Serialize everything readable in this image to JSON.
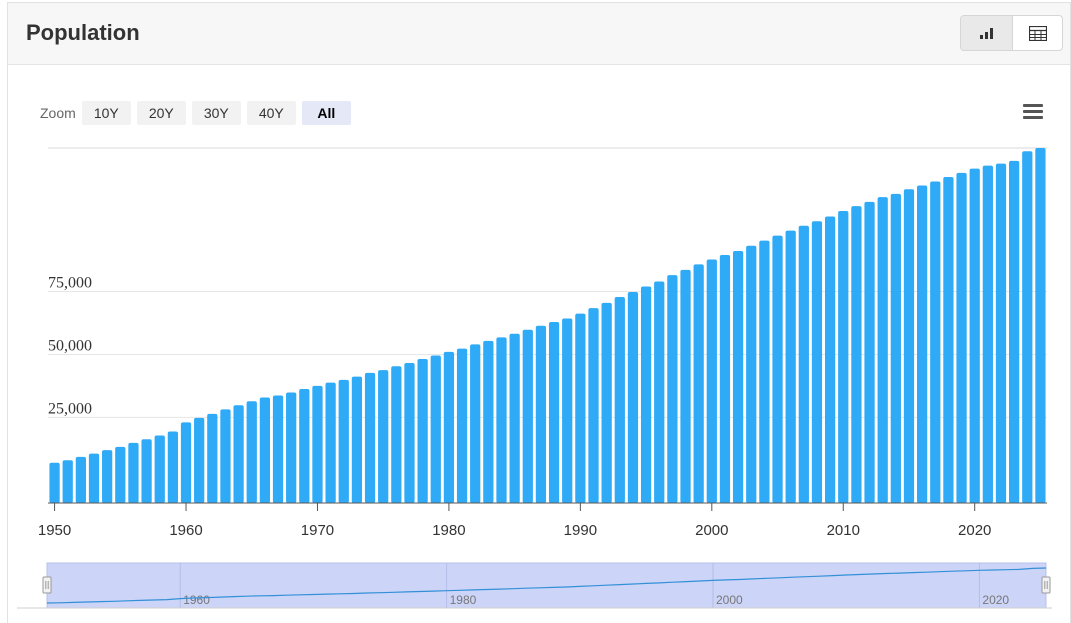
{
  "header": {
    "title": "Population"
  },
  "view_toggle": {
    "chart_icon": "bar-chart-icon",
    "table_icon": "table-icon"
  },
  "zoom": {
    "label": "Zoom",
    "options": [
      "10Y",
      "20Y",
      "30Y",
      "40Y",
      "All"
    ],
    "active": "All"
  },
  "menu_icon": "hamburger-menu-icon",
  "colors": {
    "bar": "#2eaaf7",
    "navigator_fill": "#ccd4f7",
    "navigator_line": "#3390d8",
    "grid": "#e6e6e6"
  },
  "chart_data": {
    "type": "bar",
    "title": "Population",
    "x": [
      1950,
      1951,
      1952,
      1953,
      1954,
      1955,
      1956,
      1957,
      1958,
      1959,
      1960,
      1961,
      1962,
      1963,
      1964,
      1965,
      1966,
      1967,
      1968,
      1969,
      1970,
      1971,
      1972,
      1973,
      1974,
      1975,
      1976,
      1977,
      1978,
      1979,
      1980,
      1981,
      1982,
      1983,
      1984,
      1985,
      1986,
      1987,
      1988,
      1989,
      1990,
      1991,
      1992,
      1993,
      1994,
      1995,
      1996,
      1997,
      1998,
      1999,
      2000,
      2001,
      2002,
      2003,
      2004,
      2005,
      2006,
      2007,
      2008,
      2009,
      2010,
      2011,
      2012,
      2013,
      2014,
      2015,
      2016,
      2017,
      2018,
      2019,
      2020,
      2021,
      2022,
      2023,
      2024,
      2025
    ],
    "values": [
      7000,
      8000,
      9300,
      10600,
      12000,
      13300,
      14900,
      16300,
      17800,
      19400,
      23000,
      24800,
      26400,
      28200,
      29800,
      31400,
      32900,
      33700,
      34900,
      36300,
      37500,
      38800,
      39900,
      41200,
      42700,
      43800,
      45300,
      46600,
      48200,
      49600,
      51000,
      52300,
      54000,
      55400,
      56800,
      58200,
      59800,
      61400,
      62900,
      64300,
      66200,
      68400,
      70500,
      72800,
      74800,
      77000,
      79000,
      81500,
      83600,
      85800,
      87700,
      89500,
      91100,
      93200,
      95200,
      97200,
      99200,
      101100,
      102900,
      104800,
      107000,
      108900,
      110600,
      112500,
      113800,
      115600,
      117100,
      118700,
      120500,
      122100,
      123800,
      125000,
      125800,
      126900,
      130700,
      132000
    ],
    "xlabel": "",
    "ylabel": "",
    "x_ticks": [
      1950,
      1960,
      1970,
      1980,
      1990,
      2000,
      2010,
      2020
    ],
    "y_ticks": [
      25000,
      50000,
      75000
    ],
    "y_tick_labels": [
      "25,000",
      "50,000",
      "75,000"
    ],
    "ylim": [
      -9000,
      132000
    ],
    "grid": true,
    "legend": "none",
    "navigator": {
      "x_ticks": [
        1960,
        1980,
        2000,
        2020
      ]
    }
  }
}
